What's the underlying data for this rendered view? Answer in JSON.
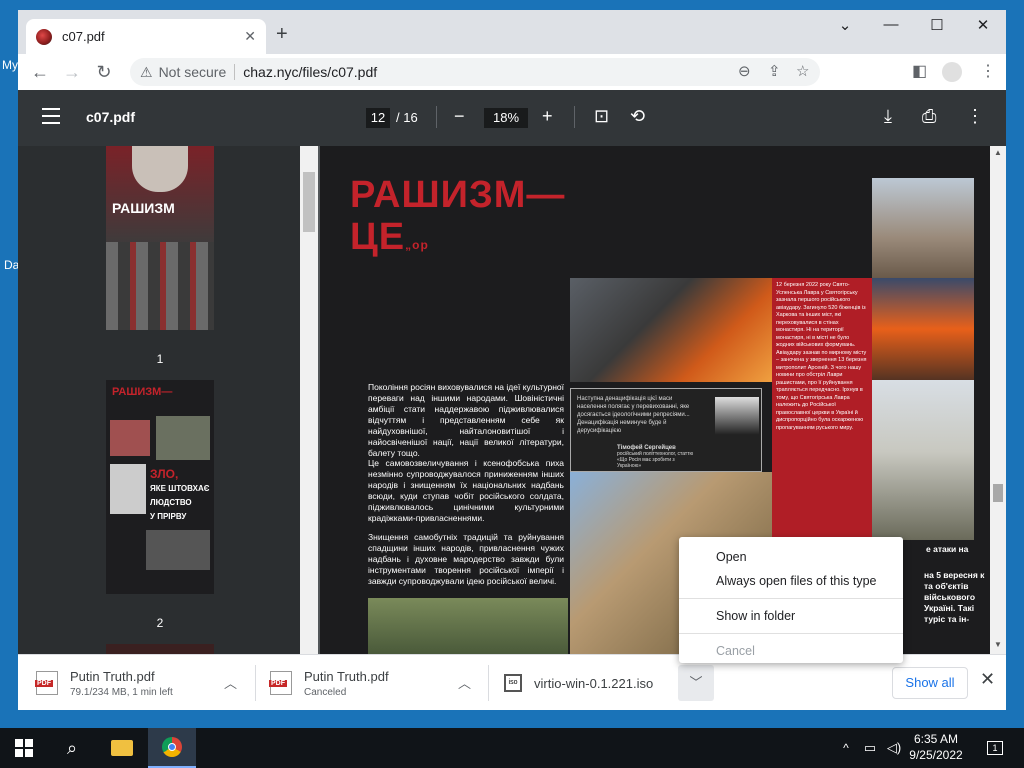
{
  "desktop": {
    "labels": [
      "My",
      "Da"
    ]
  },
  "tab": {
    "title": "c07.pdf",
    "close": "✕",
    "new_tab": "+"
  },
  "window_controls": {
    "dropdown": "⌄",
    "minimize": "—",
    "maximize": "☐",
    "close": "✕"
  },
  "nav": {
    "back": "←",
    "forward": "→",
    "reload": "↻"
  },
  "omnibox": {
    "security": "Not secure",
    "url": "chaz.nyc/files/c07.pdf"
  },
  "pdf": {
    "filename": "c07.pdf",
    "page": "12",
    "total": "/ 16",
    "zoom": "18%",
    "thumbs": [
      {
        "label": "1"
      },
      {
        "label": "2"
      }
    ],
    "page_title_l1": "РАШИЗМ—",
    "page_title_l2": "ЦЕ",
    "page_title_sup": "„ор",
    "paragraph1": "Покоління росіян виховувалися на ідеї культурної переваги над іншими народами. Шовіністичні амбіції стати наддержавою підживлювалися відчуттям і представленням себе як найдуховнішої, найталоновитішої і найосвіченішої нації, нації великої літератури, балету тощо.",
    "paragraph2": "Це самовозвеличування і ксенофобська пиха незмінно супроводжувалося приниженням інших народів і знищенням їх національних надбань всюди, куди ступав чобіт російського солдата, підживлювалось цинічними культурними крадіжками-привласненнями.",
    "paragraph3": "Знищення самобутніх традицій та руйнування спадщини інших народів, привласнення чужих надбань і духовне мародерство завжди були інструментами творення російської імперії і завжди супроводжували ідею російської величі.",
    "redbox": "12 березня 2022 року Свято-Успенська Лавра у Святогірську зазнала першого російського авіаудару. Загинуло 520 біженців із Харкова та інших міст, які переховувалися в стінах монастиря. Ні на території монастиря, ні в місті не було жодних військових формувань. Авіаудару зазнав по мирному місту – заночена у звернення 13 березня митрополит Арсеній. З чого нашу новини про обстріл Лаври рашистами, про її руйнування трапляється передчасно. Ірхнув в тому, що Святогірська Лавра належить до Російської православної церкви в Україні й диспропорційно була оскарженою пропагуванням руського миру.",
    "quote_text": "Наступна денацифікація цієї маси населення полягає у перевихованні, яке досягається ідеологічними репресіями... Денацифікація неминуче буде й дерусифікацією",
    "quote_author": "Тімофей Сергейцев",
    "quote_role": "російський політтехнолог, статтю «Що Росія має зробити з Україною»",
    "right_frag1": "е атаки на",
    "right_frag2": "на 5 вересня к та об'єктів військового Україні. Такі туріс та ін-"
  },
  "downloads": [
    {
      "name": "Putin Truth.pdf",
      "status": "79.1/234 MB, 1 min left",
      "icon": "pdf-icon"
    },
    {
      "name": "Putin Truth.pdf",
      "status": "Canceled",
      "icon": "pdf-icon"
    },
    {
      "name": "virtio-win-0.1.221.iso",
      "status": "",
      "icon": "iso-icon"
    }
  ],
  "download_bar": {
    "show_all": "Show all",
    "close": "✕"
  },
  "context_menu": {
    "open": "Open",
    "always_open": "Always open files of this type",
    "show_in_folder": "Show in folder",
    "cancel": "Cancel"
  },
  "taskbar": {
    "time": "6:35 AM",
    "date": "9/25/2022",
    "notifications": "1"
  },
  "colors": {
    "pdf_toolbar": "#323639",
    "accent": "#1a73e8",
    "title_red": "#c4232b"
  }
}
